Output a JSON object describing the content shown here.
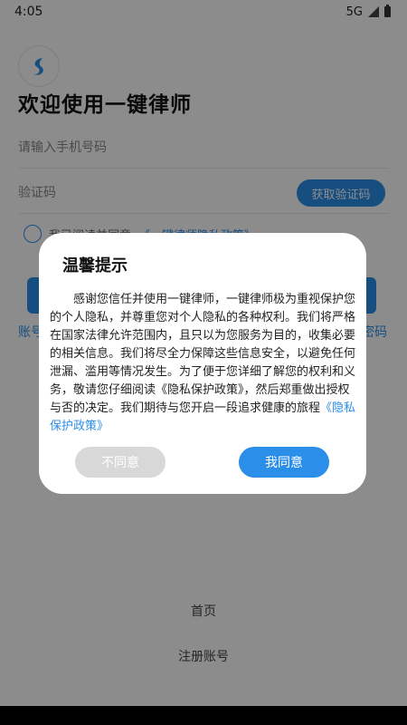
{
  "status": {
    "time": "4:05",
    "network": "5G"
  },
  "login": {
    "welcome": "欢迎使用一键律师",
    "phone_placeholder": "请输入手机号码",
    "code_placeholder": "验证码",
    "get_code": "获取验证码",
    "agree_prefix": "我已阅读并同意",
    "agree_link": "《一键律师隐私政策》",
    "alt_left": "账号",
    "alt_right": "密码",
    "home": "首页",
    "register": "注册账号"
  },
  "dialog": {
    "title": "温馨提示",
    "body": "感谢您信任并使用一键律师，一键律师极为重视保护您的个人隐私，并尊重您对个人隐私的各种权利。我们将严格在国家法律允许范围内，且只以为您服务为目的，收集必要的相关信息。我们将尽全力保障这些信息安全，以避免任何泄漏、滥用等情况发生。为了便于您详细了解您的权利和义务，敬请您仔细阅读《隐私保护政策》，然后郑重做出授权与否的决定。我们期待与您开启一段追求健康的旅程",
    "policy_link": "《隐私保护政策》",
    "decline": "不同意",
    "agree": "我同意"
  },
  "colors": {
    "accent": "#2b8ee9",
    "overlay": "rgba(0,0,0,0.45)",
    "decline_bg": "#d8d8d8"
  },
  "icons": {
    "status_signal": "signal-icon",
    "status_battery": "battery-icon",
    "logo": "app-logo-icon"
  }
}
